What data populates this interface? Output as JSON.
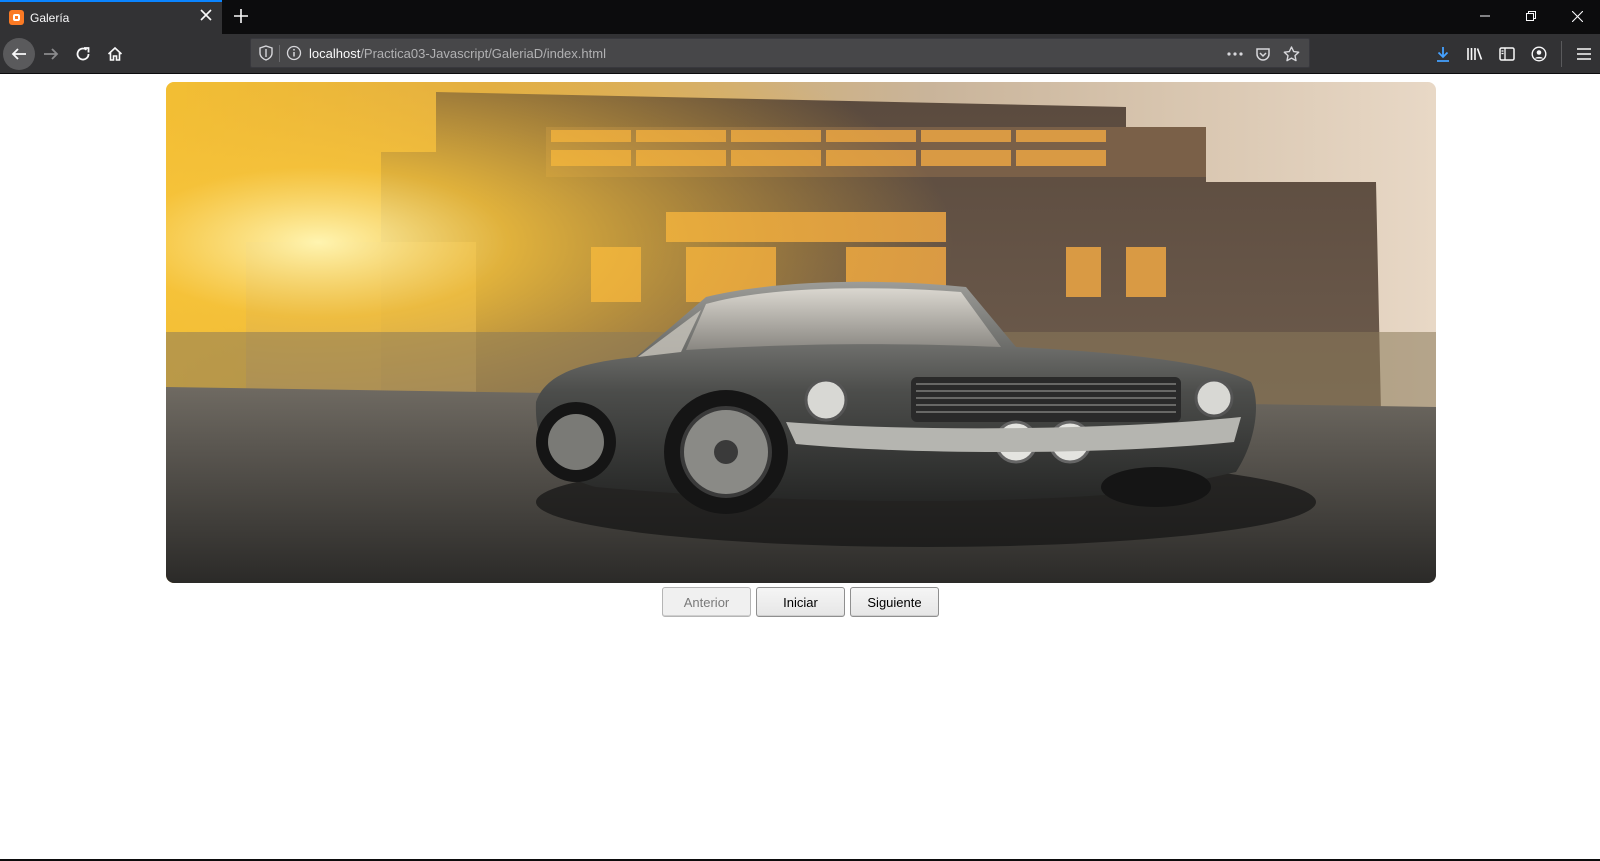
{
  "browser": {
    "tab_title": "Galería",
    "url_host": "localhost",
    "url_path": "/Practica03-Javascript/GaleriaD/index.html",
    "accent_color": "#0a84ff"
  },
  "icons": {
    "favicon": "xampp-icon",
    "back": "back-arrow-icon",
    "forward": "forward-arrow-icon",
    "reload": "reload-icon",
    "home": "home-icon",
    "tracking": "shield-icon",
    "site_info": "info-icon",
    "page_actions": "more-dots-icon",
    "pocket": "pocket-icon",
    "bookmark": "star-icon",
    "downloads": "download-icon",
    "library": "library-icon",
    "sidebar": "sidebar-icon",
    "account": "account-icon",
    "menu": "hamburger-menu-icon"
  },
  "gallery": {
    "image_subject": "car-in-front-of-building-at-sunset",
    "buttons": {
      "prev": "Anterior",
      "start": "Iniciar",
      "next": "Siguiente"
    }
  }
}
